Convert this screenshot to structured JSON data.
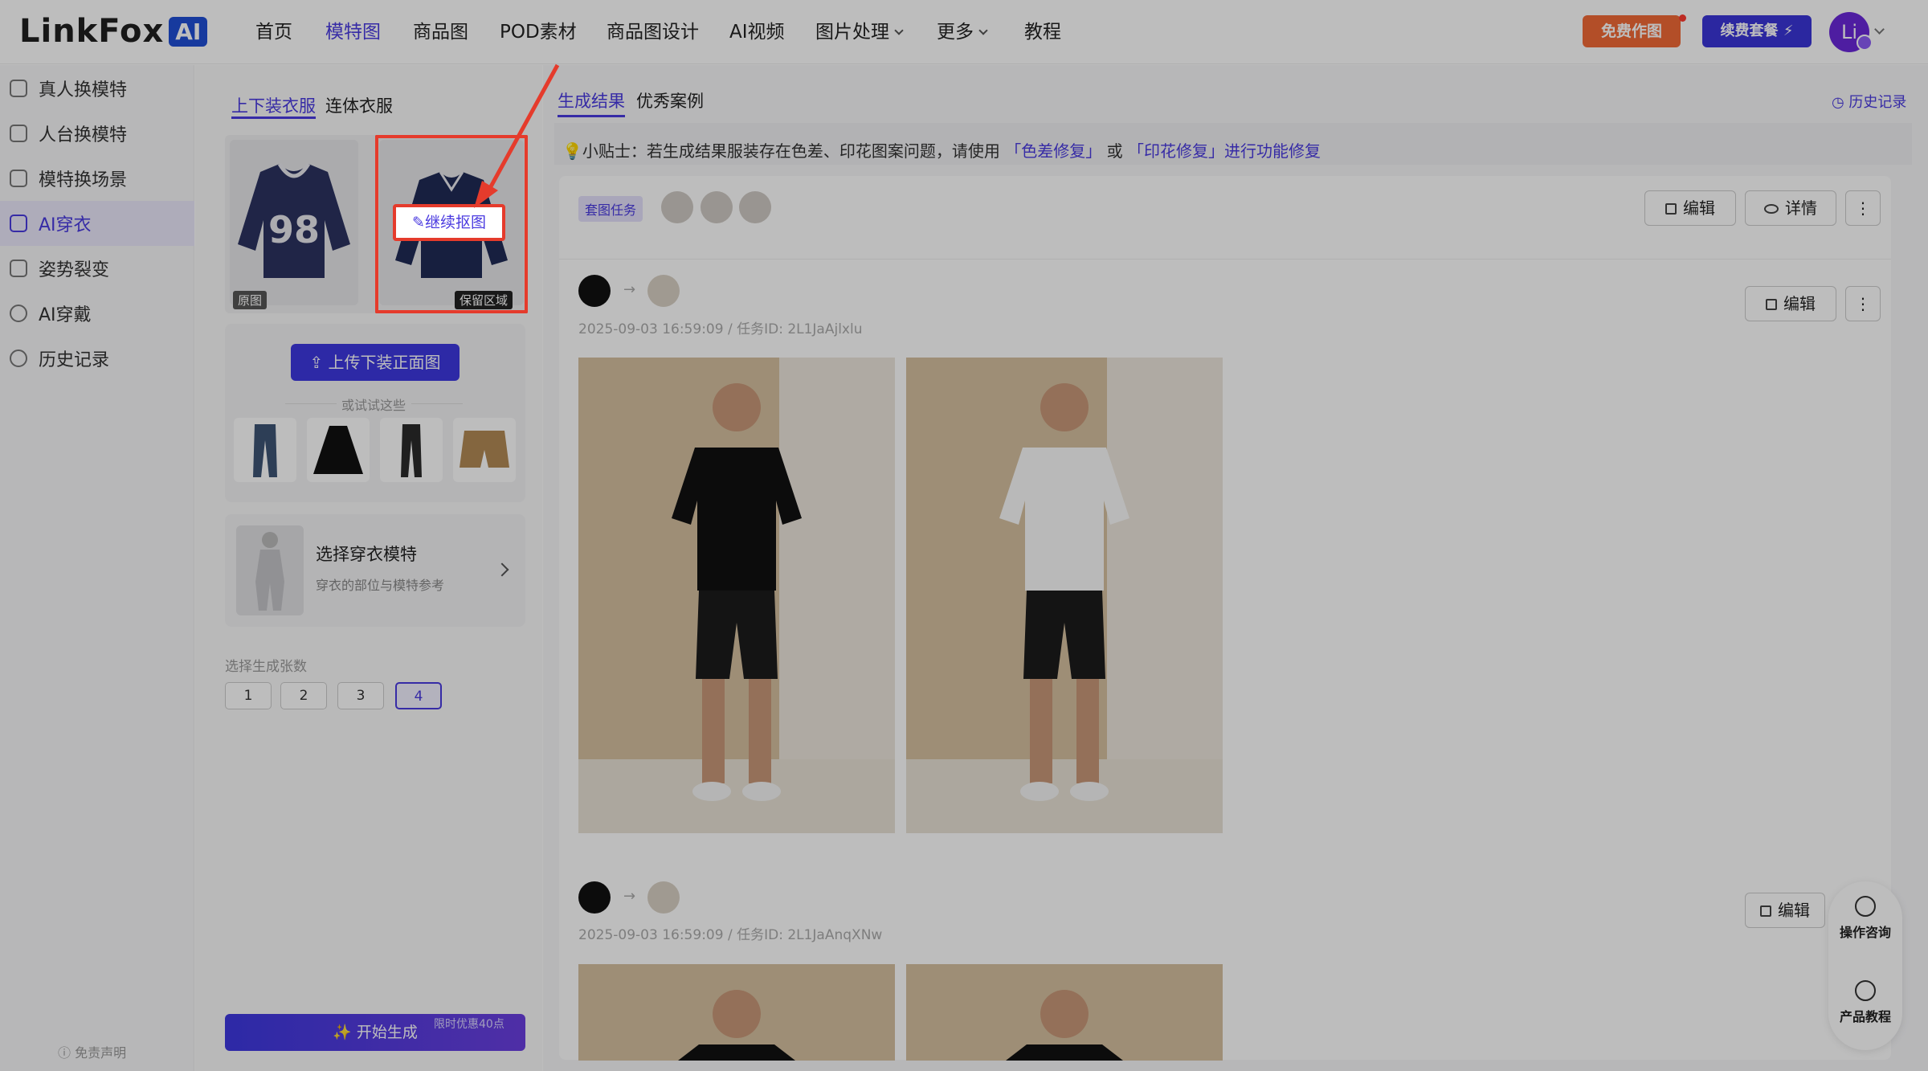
{
  "logo": {
    "text": "LinkFox",
    "badge": "AI"
  },
  "nav": [
    {
      "label": "首页"
    },
    {
      "label": "模特图"
    },
    {
      "label": "商品图"
    },
    {
      "label": "POD素材"
    },
    {
      "label": "商品图设计"
    },
    {
      "label": "AI视频"
    },
    {
      "label": "图片处理"
    },
    {
      "label": "更多"
    },
    {
      "label": "教程"
    }
  ],
  "header": {
    "free_btn": "免费作图",
    "renew_btn": "续费套餐 ⚡",
    "avatar": "Li"
  },
  "sidebar": {
    "items": [
      {
        "label": "真人换模特"
      },
      {
        "label": "人台换模特"
      },
      {
        "label": "模特换场景"
      },
      {
        "label": "AI穿衣"
      },
      {
        "label": "姿势裂变"
      },
      {
        "label": "AI穿戴"
      },
      {
        "label": "历史记录"
      }
    ],
    "disclaimer": "ⓘ 免责声明"
  },
  "left": {
    "tabs": [
      "上下装衣服",
      "连体衣服"
    ],
    "original_label": "原图",
    "keep_label": "保留区域",
    "continue_btn": "✎继续抠图",
    "upload_btn": "⇪  上传下装正面图",
    "or_try": "或试试这些",
    "model_title": "选择穿衣模特",
    "model_sub": "穿衣的部位与模特参考",
    "count_label": "选择生成张数",
    "counts": [
      "1",
      "2",
      "3",
      "4"
    ],
    "start_btn": "✨ 开始生成",
    "promo": "限时优惠40点"
  },
  "main": {
    "tabs": [
      "生成结果",
      "优秀案例"
    ],
    "history": "◷ 历史记录",
    "tip_prefix": "💡小贴士：若生成结果服装存在色差、印花图案问题，请使用 ",
    "tip_link1": "「色差修复」",
    "tip_mid": " 或 ",
    "tip_link2": "「印花修复」进行功能修复",
    "task_tag": "套图任务",
    "edit": "编辑",
    "detail": "详情",
    "row1_meta": "2025-09-03 16:59:09 / 任务ID: 2L1JaAjlxlu",
    "row2_meta": "2025-09-03 16:59:09 / 任务ID: 2L1JaAnqXNw"
  },
  "float": {
    "consult": "操作咨询",
    "tutorial": "产品教程"
  },
  "colors": {
    "accent": "#4a3ae0",
    "highlight": "#e53b2c",
    "free": "#f26a37"
  }
}
